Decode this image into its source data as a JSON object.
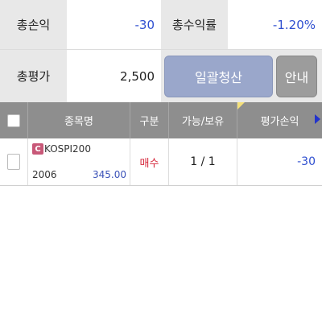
{
  "summary": {
    "total_pl_label": "총손익",
    "total_pl_value": "-30",
    "total_return_label": "총수익률",
    "total_return_value": "-1.20%",
    "total_eval_label": "총평가",
    "total_eval_value": "2,500",
    "liquidate_all_label": "일괄청산",
    "info_label": "안내"
  },
  "table": {
    "headers": {
      "name": "종목명",
      "type": "구분",
      "qty": "가능/보유",
      "eval_pl": "평가손익"
    },
    "rows": [
      {
        "badge": "C",
        "name": "KOSPI200",
        "code": "2006",
        "price": "345.00",
        "type": "매수",
        "qty": "1 / 1",
        "eval_pl": "-30"
      }
    ]
  },
  "colors": {
    "negative": "#2f4fd0",
    "buy": "#d6283c",
    "header_bg": "#8e8e8e",
    "label_bg": "#e8e8e8",
    "liquidate_btn": "#9aa7cb",
    "info_btn": "#9c9c9c"
  }
}
